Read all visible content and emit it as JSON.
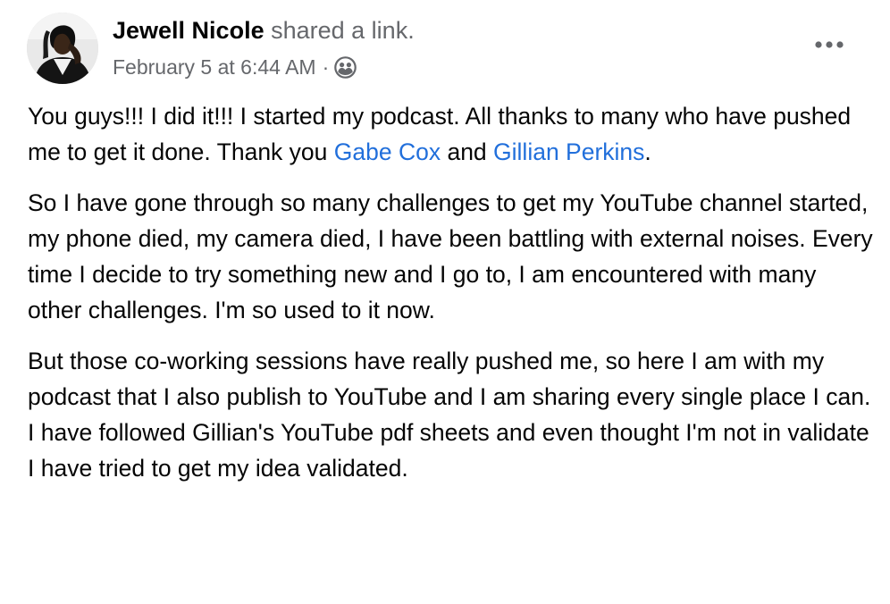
{
  "post": {
    "author": "Jewell Nicole",
    "action": "shared a link.",
    "timestamp": "February 5 at 6:44 AM",
    "separator": "·",
    "audience_icon": "friends-icon",
    "more_icon": "more-options-icon",
    "paragraphs": {
      "p1": {
        "text_before": "You guys!!! I did it!!! I started my podcast. All thanks to many who have pushed me to get it done. Thank you ",
        "mention_1": "Gabe Cox",
        "text_middle": " and ",
        "mention_2": "Gillian Perkins",
        "text_after": "."
      },
      "p2": "So I have gone through so many challenges to get my YouTube channel started, my phone died, my camera died, I have been battling with external noises. Every time I decide to try something new and I go to, I am encountered with many other challenges. I'm so used to it now.",
      "p3": "But those co-working sessions have really pushed me, so here I am with my podcast that I also publish to YouTube and I am sharing every single place I can. I have followed Gillian's YouTube pdf sheets and even thought I'm not in validate  I have tried to get my idea validated."
    },
    "colors": {
      "text": "#050505",
      "secondary": "#65676b",
      "link": "#216fdb"
    }
  }
}
